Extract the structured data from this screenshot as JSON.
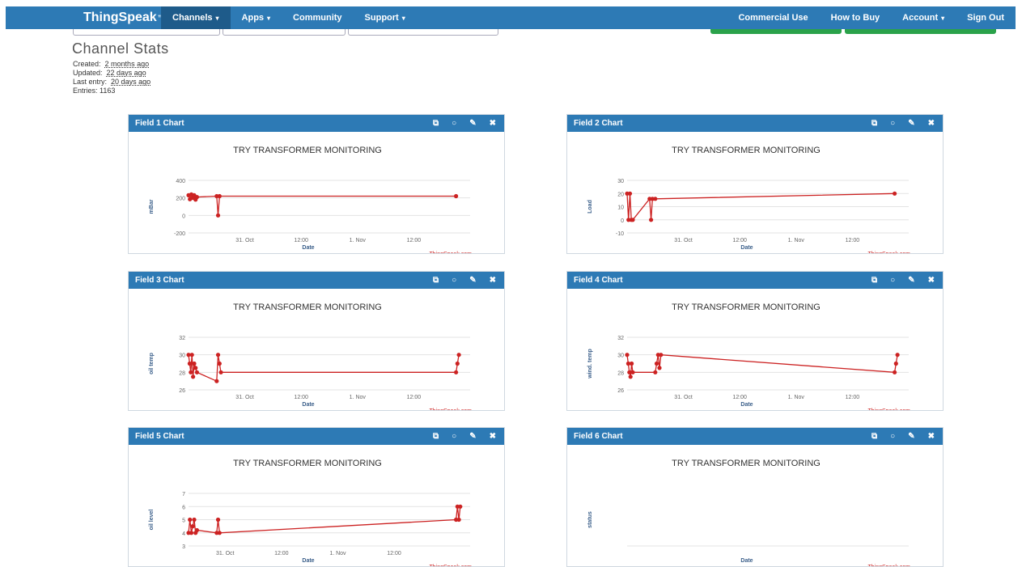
{
  "nav": {
    "brand": "ThingSpeak",
    "brand_tm": "™",
    "left": [
      {
        "label": "Channels",
        "dropdown": true,
        "active": true
      },
      {
        "label": "Apps",
        "dropdown": true
      },
      {
        "label": "Community",
        "dropdown": false
      },
      {
        "label": "Support",
        "dropdown": true
      }
    ],
    "right": [
      {
        "label": "Commercial Use",
        "dropdown": false
      },
      {
        "label": "How to Buy",
        "dropdown": false
      },
      {
        "label": "Account",
        "dropdown": true
      },
      {
        "label": "Sign Out",
        "dropdown": false
      }
    ]
  },
  "stats": {
    "title": "Channel Stats",
    "created_label": "Created:",
    "created": "2 months ago",
    "updated_label": "Updated:",
    "updated": "22 days ago",
    "last_entry_label": "Last entry:",
    "last_entry": "20 days ago",
    "entries_label": "Entries:",
    "entries": "1163"
  },
  "colors": {
    "accent": "#2d7ab5",
    "series": "#cc2222",
    "credit": "#cc2222",
    "green": "#2aa24a"
  },
  "chart_data": [
    {
      "type": "line",
      "panel_title": "Field 1 Chart",
      "title": "TRY TRANSFORMER MONITORING",
      "xlabel": "Date",
      "ylabel": "mBar",
      "credit": "ThingSpeak.com",
      "ylim": [
        -200,
        400
      ],
      "yticks": [
        -200,
        0,
        200,
        400
      ],
      "xlim": [
        0,
        100
      ],
      "xticks": [
        {
          "x": 20,
          "label": "31. Oct"
        },
        {
          "x": 40,
          "label": "12:00"
        },
        {
          "x": 60,
          "label": "1. Nov"
        },
        {
          "x": 80,
          "label": "12:00"
        }
      ],
      "series": [
        {
          "points": [
            [
              0,
              230
            ],
            [
              0.5,
              185
            ],
            [
              1,
              240
            ],
            [
              1.5,
              200
            ],
            [
              2,
              230
            ],
            [
              2.5,
              180
            ],
            [
              3,
              210
            ],
            [
              10,
              220
            ],
            [
              10.5,
              0
            ],
            [
              11,
              220
            ],
            [
              95,
              220
            ]
          ]
        }
      ]
    },
    {
      "type": "line",
      "panel_title": "Field 2 Chart",
      "title": "TRY TRANSFORMER MONITORING",
      "xlabel": "Date",
      "ylabel": "Load",
      "credit": "ThingSpeak.com",
      "ylim": [
        -10,
        30
      ],
      "yticks": [
        -10,
        0,
        10,
        20,
        30
      ],
      "xlim": [
        0,
        100
      ],
      "xticks": [
        {
          "x": 20,
          "label": "31. Oct"
        },
        {
          "x": 40,
          "label": "12:00"
        },
        {
          "x": 60,
          "label": "1. Nov"
        },
        {
          "x": 80,
          "label": "12:00"
        }
      ],
      "series": [
        {
          "points": [
            [
              0,
              20
            ],
            [
              0.5,
              0
            ],
            [
              1,
              20
            ],
            [
              1.5,
              0
            ],
            [
              2,
              0
            ],
            [
              8,
              16
            ],
            [
              8.5,
              0
            ],
            [
              9,
              16
            ],
            [
              10,
              16
            ],
            [
              95,
              20
            ]
          ]
        }
      ]
    },
    {
      "type": "line",
      "panel_title": "Field 3 Chart",
      "title": "TRY TRANSFORMER MONITORING",
      "xlabel": "Date",
      "ylabel": "oil temp",
      "credit": "ThingSpeak.com",
      "ylim": [
        26,
        32
      ],
      "yticks": [
        26,
        28,
        30,
        32
      ],
      "xlim": [
        0,
        100
      ],
      "xticks": [
        {
          "x": 20,
          "label": "31. Oct"
        },
        {
          "x": 40,
          "label": "12:00"
        },
        {
          "x": 60,
          "label": "1. Nov"
        },
        {
          "x": 80,
          "label": "12:00"
        }
      ],
      "series": [
        {
          "points": [
            [
              0,
              30
            ],
            [
              0.4,
              29
            ],
            [
              0.8,
              28
            ],
            [
              1.2,
              30
            ],
            [
              1.6,
              27.5
            ],
            [
              2,
              29
            ],
            [
              2.5,
              28.5
            ],
            [
              3,
              28
            ],
            [
              10,
              27
            ],
            [
              10.5,
              30
            ],
            [
              11,
              29
            ],
            [
              11.5,
              28
            ],
            [
              95,
              28
            ],
            [
              95.5,
              29
            ],
            [
              96,
              30
            ]
          ]
        }
      ]
    },
    {
      "type": "line",
      "panel_title": "Field 4 Chart",
      "title": "TRY TRANSFORMER MONITORING",
      "xlabel": "Date",
      "ylabel": "wind. temp",
      "credit": "ThingSpeak.com",
      "ylim": [
        26,
        32
      ],
      "yticks": [
        26,
        28,
        30,
        32
      ],
      "xlim": [
        0,
        100
      ],
      "xticks": [
        {
          "x": 20,
          "label": "31. Oct"
        },
        {
          "x": 40,
          "label": "12:00"
        },
        {
          "x": 60,
          "label": "1. Nov"
        },
        {
          "x": 80,
          "label": "12:00"
        }
      ],
      "series": [
        {
          "points": [
            [
              0,
              30
            ],
            [
              0.4,
              29
            ],
            [
              0.8,
              28
            ],
            [
              1.2,
              27.5
            ],
            [
              1.6,
              29
            ],
            [
              2,
              28
            ],
            [
              10,
              28
            ],
            [
              10.5,
              29
            ],
            [
              11,
              30
            ],
            [
              11.5,
              28.5
            ],
            [
              12,
              30
            ],
            [
              95,
              28
            ],
            [
              95.5,
              29
            ],
            [
              96,
              30
            ]
          ]
        }
      ]
    },
    {
      "type": "line",
      "panel_title": "Field 5 Chart",
      "title": "TRY TRANSFORMER MONITORING",
      "xlabel": "Date",
      "ylabel": "oil level",
      "credit": "ThingSpeak.com",
      "ylim": [
        3,
        7
      ],
      "yticks": [
        3,
        4,
        5,
        6,
        7
      ],
      "xlim": [
        0,
        100
      ],
      "xticks": [
        {
          "x": 13,
          "label": "31. Oct"
        },
        {
          "x": 33,
          "label": "12:00"
        },
        {
          "x": 53,
          "label": "1. Nov"
        },
        {
          "x": 73,
          "label": "12:00"
        }
      ],
      "series": [
        {
          "points": [
            [
              0,
              4
            ],
            [
              0.5,
              5
            ],
            [
              1,
              4
            ],
            [
              1.5,
              4.5
            ],
            [
              2,
              5
            ],
            [
              2.5,
              4
            ],
            [
              3,
              4.2
            ],
            [
              10,
              4
            ],
            [
              10.5,
              5
            ],
            [
              11,
              4
            ],
            [
              95,
              5
            ],
            [
              95.5,
              6
            ],
            [
              96,
              5
            ],
            [
              96.5,
              6
            ]
          ]
        }
      ]
    },
    {
      "type": "line",
      "panel_title": "Field 6 Chart",
      "title": "TRY TRANSFORMER MONITORING",
      "xlabel": "Date",
      "ylabel": "status",
      "credit": "ThingSpeak.com",
      "ylim": [
        0,
        1
      ],
      "yticks": [],
      "xlim": [
        0,
        100
      ],
      "xticks": [],
      "series": []
    }
  ]
}
